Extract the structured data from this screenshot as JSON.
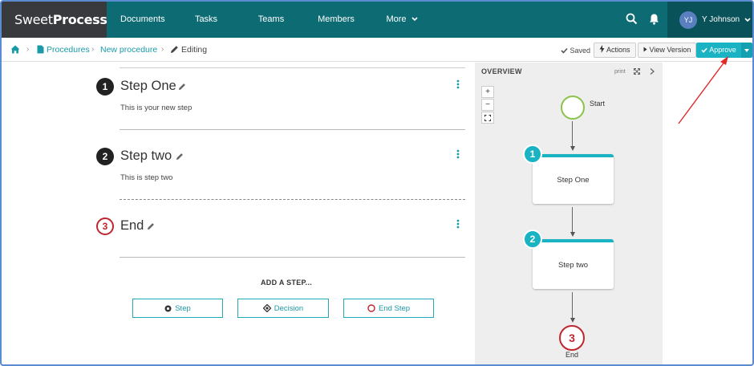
{
  "brand": {
    "name_light": "Sweet",
    "name_bold": "Process"
  },
  "nav": {
    "items": [
      {
        "label": "Documents"
      },
      {
        "label": "Tasks"
      },
      {
        "label": "Teams"
      },
      {
        "label": "Members"
      },
      {
        "label": "More"
      }
    ],
    "user": {
      "initials": "YJ",
      "name": "Y Johnson"
    }
  },
  "breadcrumb": {
    "home_icon": "home-icon",
    "items": [
      {
        "label": "Procedures"
      },
      {
        "label": "New procedure"
      }
    ],
    "current": "Editing"
  },
  "toolbar": {
    "saved": "Saved",
    "actions": "Actions",
    "view_version": "View Version",
    "approve": "Approve"
  },
  "steps": [
    {
      "number": "1",
      "title": "Step One",
      "description": "This is your new step"
    },
    {
      "number": "2",
      "title": "Step two",
      "description": "This is step two"
    },
    {
      "number": "3",
      "title": "End",
      "description": ""
    }
  ],
  "add_step": {
    "heading": "ADD A STEP...",
    "buttons": [
      {
        "label": "Step"
      },
      {
        "label": "Decision"
      },
      {
        "label": "End Step"
      }
    ]
  },
  "overview": {
    "title": "OVERVIEW",
    "print": "print",
    "zoom_in": "+",
    "zoom_out": "−",
    "start_label": "Start",
    "end_label": "End",
    "end_number": "3",
    "nodes": [
      {
        "number": "1",
        "label": "Step One"
      },
      {
        "number": "2",
        "label": "Step two"
      }
    ]
  },
  "colors": {
    "navbar": "#0d6b74",
    "accent": "#1ab3c4",
    "end_red": "#c0262e",
    "start_green": "#8bc34a"
  }
}
